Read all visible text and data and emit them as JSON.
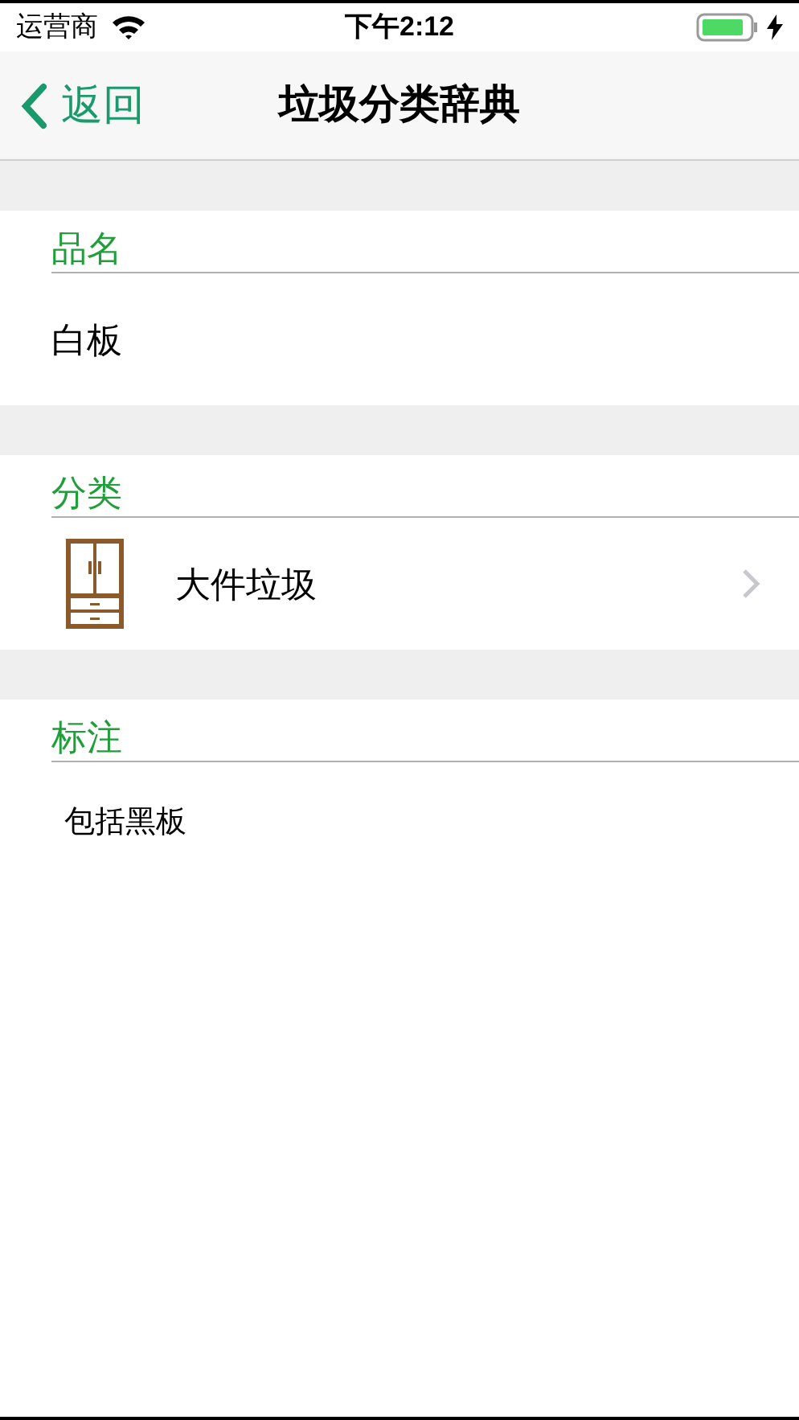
{
  "status_bar": {
    "carrier": "运营商",
    "time": "下午2:12"
  },
  "nav": {
    "back_label": "返回",
    "title": "垃圾分类辞典"
  },
  "sections": [
    {
      "kind": "text",
      "header": "品名",
      "value": "白板"
    },
    {
      "kind": "category",
      "header": "分类",
      "value": "大件垃圾"
    },
    {
      "kind": "note",
      "header": "标注",
      "value": "包括黑板"
    }
  ]
}
